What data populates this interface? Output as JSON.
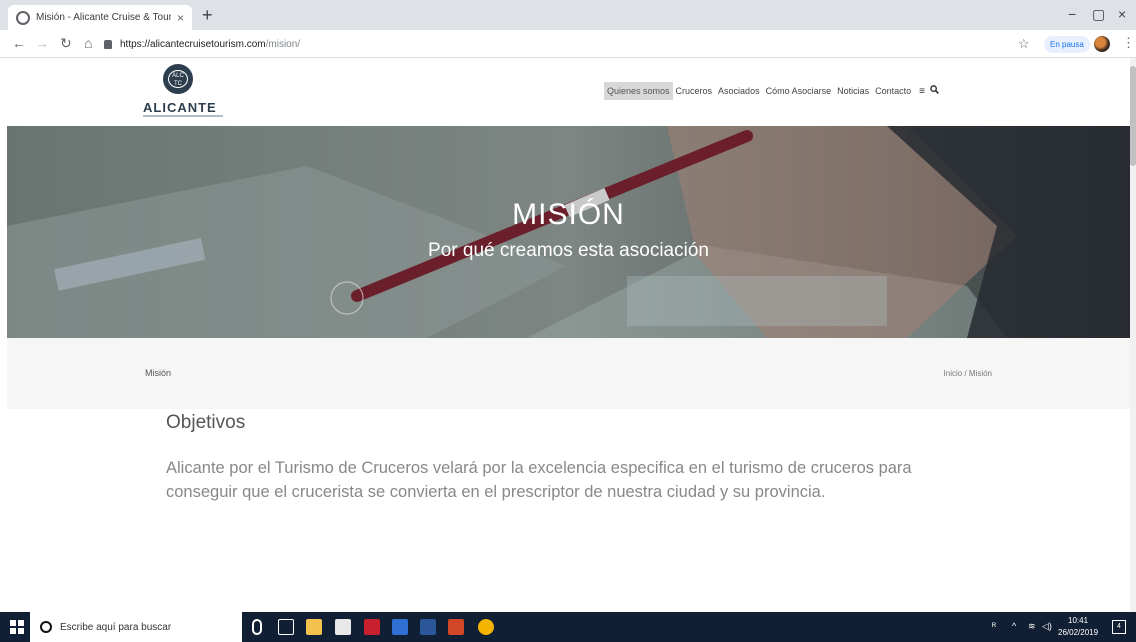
{
  "browser": {
    "tab_title": "Misión - Alicante Cruise & Touri",
    "tab_close": "×",
    "new_tab": "+",
    "url_host": "https://alicantecruisetourism.com",
    "url_path": "/mision/",
    "profile_status": "En pausa",
    "window_controls": [
      "−",
      "▢",
      "×"
    ],
    "nav_icons": [
      "arrow-back-icon",
      "arrow-forward-icon",
      "reload-icon",
      "home-icon"
    ]
  },
  "site": {
    "logo_mark": "ALC TC",
    "logo_text": "ALICANTE",
    "nav": [
      {
        "label": "Quienes somos",
        "active": true
      },
      {
        "label": "Cruceros",
        "active": false
      },
      {
        "label": "Asociados",
        "active": false
      },
      {
        "label": "Cómo Asociarse",
        "active": false
      },
      {
        "label": "Noticias",
        "active": false
      },
      {
        "label": "Contacto",
        "active": false
      }
    ],
    "hero": {
      "title": "MISIÓN",
      "subtitle": "Por qué creamos esta asociación"
    },
    "breadcrumb": {
      "page": "Misión",
      "trail": "Inicio  /  Misión"
    },
    "content": {
      "heading": "Objetivos",
      "paragraph": "Alicante por el Turismo de Cruceros velará por la excelencia especifica en el turismo de cruceros para conseguir que el crucerista se convierta en el prescriptor de nuestra ciudad y su provincia."
    }
  },
  "taskbar": {
    "search_placeholder": "Escribe aquí para buscar",
    "time": "10:41",
    "date": "26/02/2019",
    "notification_count": "4"
  }
}
